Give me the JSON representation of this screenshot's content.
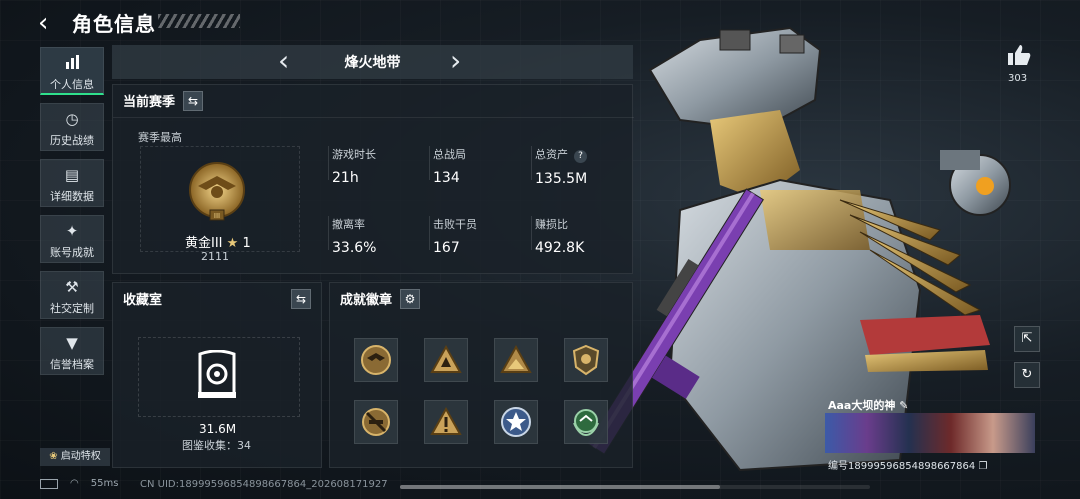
{
  "header": {
    "title": "角色信息",
    "back_icon": "back-arrow-icon"
  },
  "sidebar": {
    "items": [
      {
        "label": "个人信息",
        "icon": "bar-chart-icon",
        "active": true
      },
      {
        "label": "历史战绩",
        "icon": "clock-icon",
        "active": false
      },
      {
        "label": "详细数据",
        "icon": "folder-icon",
        "active": false
      },
      {
        "label": "账号成就",
        "icon": "trophy-icon",
        "active": false
      },
      {
        "label": "社交定制",
        "icon": "tools-icon",
        "active": false
      },
      {
        "label": "信誉档案",
        "icon": "shield-icon",
        "active": false
      }
    ],
    "privilege_label": "启动特权"
  },
  "map_selector": {
    "name": "烽火地带"
  },
  "season": {
    "heading": "当前赛季",
    "subheading": "赛季最高",
    "rank_name": "黄金III",
    "rank_stars": "1",
    "rank_score": "2111",
    "stats": [
      {
        "label": "游戏时长",
        "value": "21h"
      },
      {
        "label": "总战局",
        "value": "134"
      },
      {
        "label": "总资产",
        "value": "135.5M",
        "has_help": true
      },
      {
        "label": "撤离率",
        "value": "33.6%"
      },
      {
        "label": "击败干员",
        "value": "167"
      },
      {
        "label": "赚损比",
        "value": "492.8K"
      }
    ]
  },
  "collection": {
    "heading": "收藏室",
    "value": "31.6M",
    "count_text": "图鉴收集：34"
  },
  "achievements": {
    "heading": "成就徽章",
    "badges": [
      "eagle-badge",
      "triangle-badge-1",
      "triangle-badge-2",
      "shield-badge",
      "no-gun-badge",
      "warning-badge",
      "star-badge",
      "laurel-badge"
    ]
  },
  "like": {
    "count": "303"
  },
  "player_card": {
    "name": "Aaa大坝的神",
    "id_text": "编号18999596854898667864"
  },
  "footer": {
    "ping": "55ms",
    "uid": "CN UID:18999596854898667864_202608171927"
  },
  "colors": {
    "accent": "#2fe08c",
    "panel": "#1a2128",
    "gold": "#c9a25a"
  }
}
